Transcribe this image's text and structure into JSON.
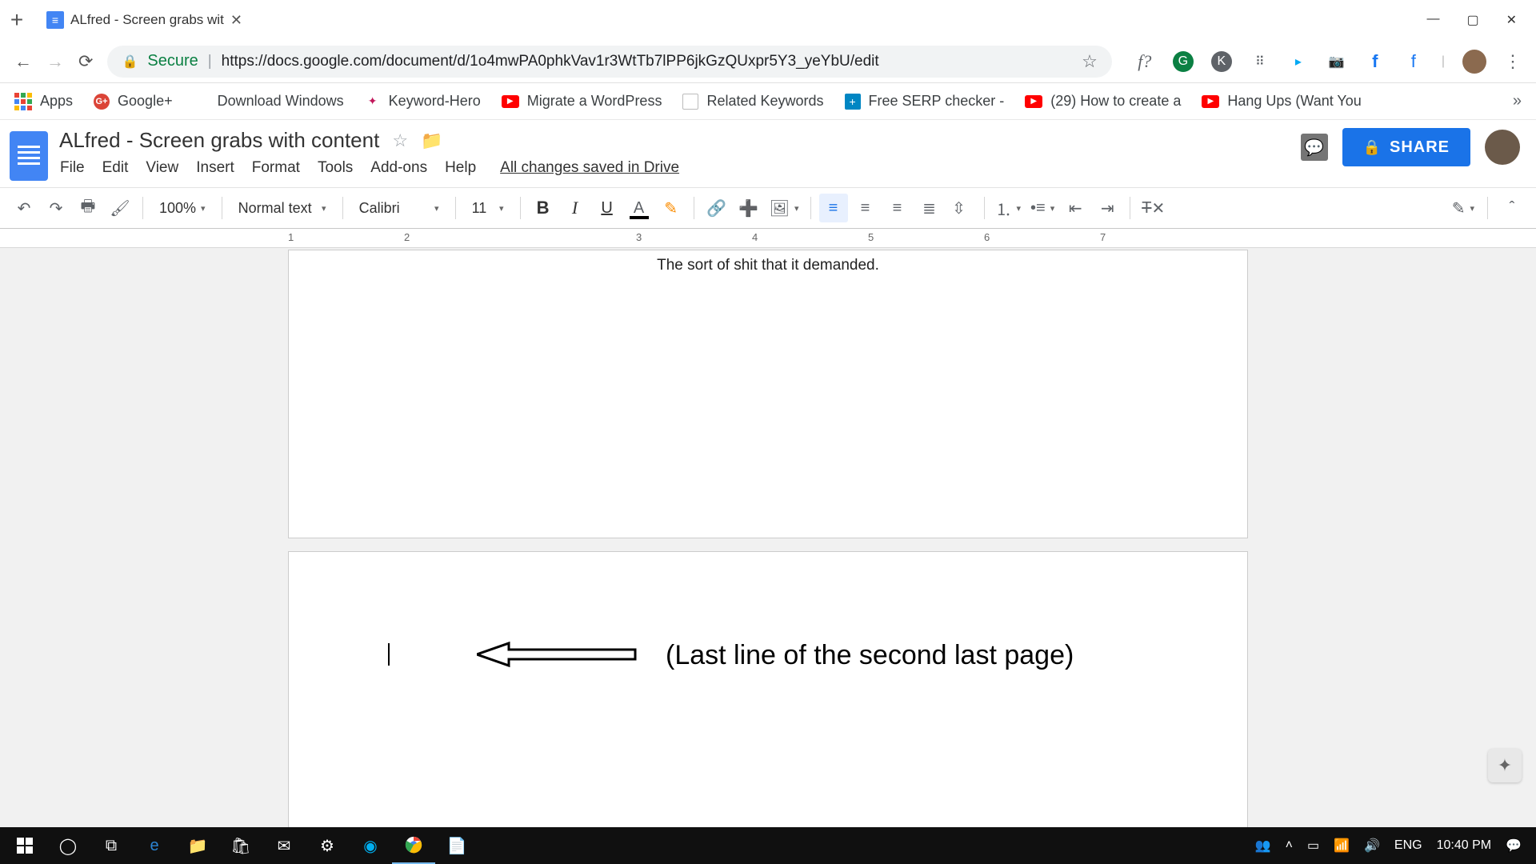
{
  "browser": {
    "tab_title": "ALfred - Screen grabs wit",
    "secure_label": "Secure",
    "url": "https://docs.google.com/document/d/1o4mwPA0phkVav1r3WtTb7lPP6jkGzQUxpr5Y3_yeYbU/edit",
    "fonts_icon_text": "f?",
    "bookmarks": {
      "apps": "Apps",
      "items": [
        {
          "label": "Google+"
        },
        {
          "label": "Download Windows"
        },
        {
          "label": "Keyword-Hero"
        },
        {
          "label": "Migrate a WordPress"
        },
        {
          "label": "Related Keywords"
        },
        {
          "label": "Free SERP checker -"
        },
        {
          "label": "(29) How to create a"
        },
        {
          "label": "Hang Ups (Want You"
        }
      ]
    }
  },
  "docs": {
    "title": "ALfred - Screen grabs with content",
    "menus": [
      "File",
      "Edit",
      "View",
      "Insert",
      "Format",
      "Tools",
      "Add-ons",
      "Help"
    ],
    "saved_text": "All changes saved in Drive",
    "share_label": "SHARE",
    "toolbar": {
      "zoom": "100%",
      "style": "Normal text",
      "font": "Calibri",
      "size": "11"
    },
    "ruler_numbers": [
      "1",
      "2",
      "3",
      "4",
      "5",
      "6",
      "7"
    ]
  },
  "document": {
    "line1": "The sort of shit that it demanded.",
    "annotation": "(Last line of the second last page)"
  },
  "taskbar": {
    "lang": "ENG",
    "time": "10:40 PM"
  }
}
